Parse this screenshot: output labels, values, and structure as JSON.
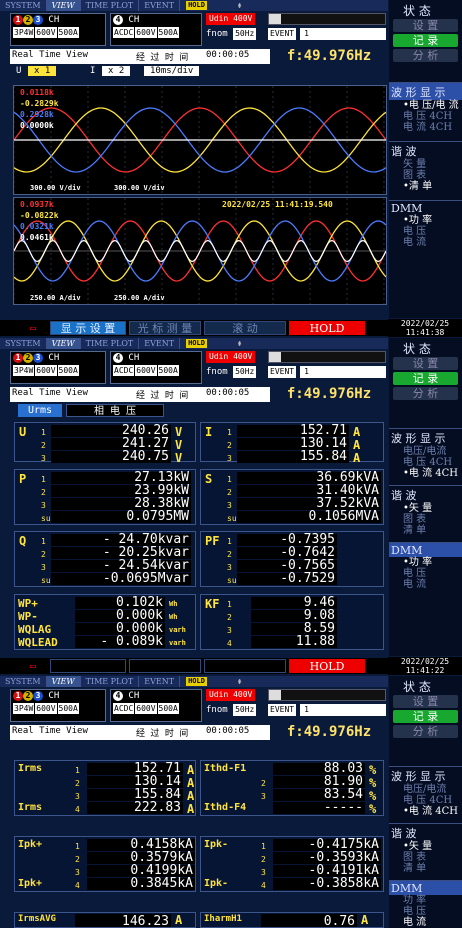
{
  "tabs": [
    "SYSTEM",
    "VIEW",
    "TIME PLOT",
    "EVENT"
  ],
  "hold_badge": "HOLD",
  "ch": {
    "ch_suffix": "CH",
    "ch4": "4",
    "wiring": "3P4W",
    "v_range": "600V",
    "a_range": "500A",
    "ch4_mode": "ACDC",
    "ch4_v": "600V",
    "ch4_a": "500A"
  },
  "udin": "Udin 400V",
  "fnom": "fnom",
  "fnom_val": "50Hz",
  "event": "EVENT",
  "event_count": "1",
  "rt": {
    "label": "Real Time View",
    "elapsed_label": "经 过 时 间",
    "elapsed": "00:00:05",
    "freq": "f:49.976Hz"
  },
  "zoom": {
    "u_label": "U",
    "u": "x 1",
    "i_label": "I",
    "i": "x 2",
    "tdiv": "10ms/div"
  },
  "wave1": {
    "v1": "0.0118k",
    "v2": "-0.2829k",
    "v3": "0.2928k",
    "v4": "0.0000k",
    "scale1": "300.00 V/div",
    "scale2": "300.00 V/div"
  },
  "wave2": {
    "a1": "0.0937k",
    "a2": "-0.0822k",
    "a3": "0.0321k",
    "a4": "0.0461k",
    "timestamp": "2022/02/25  11:41:19.540",
    "scale1": "250.00 A/div",
    "scale2": "250.00 A/div"
  },
  "bottom": {
    "b1": "显 示 设 置",
    "b2": "光 标 测 量",
    "b3": "滚 动",
    "hold": "HOLD"
  },
  "date1": "2022/02/25",
  "time1": "11:41:38",
  "date2": "2022/02/25",
  "time2": "11:41:22",
  "sidebar": {
    "status": "状 态",
    "set": "设 置",
    "rec": "记 录",
    "ana": "分 析",
    "wave": "波 形 显 示",
    "vc": "电压/电流",
    "v4": "电 压 4CH",
    "c4": "电 流 4CH",
    "harm": "谐 波",
    "vec": "矢 量",
    "graph": "图 表",
    "list": "清 单",
    "dmm": "DMM",
    "power": "功 率",
    "volt": "电 压",
    "curr": "电 流",
    "bullet": "•",
    "list_sel": "•清 单",
    "vc_sel": "•电 压/电 流",
    "power_sel": "•功 率",
    "curr4_sel": "•电 流 4CH",
    "vec_sel": "•矢 量"
  },
  "s2": {
    "urms_btn": "Urms",
    "phase_v": "相 电 压",
    "urms": {
      "label": "U",
      "sub": "rms",
      "rows": [
        [
          "1",
          "240.26",
          "V"
        ],
        [
          "2",
          "241.27",
          "V"
        ],
        [
          "3",
          "240.75",
          "V"
        ]
      ]
    },
    "irms": {
      "label": "I",
      "sub": "rms",
      "rows": [
        [
          "1",
          "152.71",
          "A"
        ],
        [
          "2",
          "130.14",
          "A"
        ],
        [
          "3",
          "155.84",
          "A"
        ]
      ]
    },
    "p": {
      "label": "P",
      "rows": [
        [
          "1",
          "27.13kW",
          ""
        ],
        [
          "2",
          "23.99kW",
          ""
        ],
        [
          "3",
          "28.38kW",
          ""
        ],
        [
          "sum",
          "0.0795MW",
          ""
        ]
      ]
    },
    "s": {
      "label": "S",
      "rows": [
        [
          "1",
          "36.69kVA",
          ""
        ],
        [
          "2",
          "31.40kVA",
          ""
        ],
        [
          "3",
          "37.52kVA",
          ""
        ],
        [
          "sum",
          "0.1056MVA",
          ""
        ]
      ]
    },
    "q": {
      "label": "Q",
      "rows": [
        [
          "1",
          "- 24.70kvar",
          ""
        ],
        [
          "2",
          "- 20.25kvar",
          ""
        ],
        [
          "3",
          "- 24.54kvar",
          ""
        ],
        [
          "sum",
          "-0.0695Mvar",
          ""
        ]
      ]
    },
    "pf": {
      "label": "PF",
      "rows": [
        [
          "1",
          "-0.7395",
          ""
        ],
        [
          "2",
          "-0.7642",
          ""
        ],
        [
          "3",
          "-0.7565",
          ""
        ],
        [
          "sum",
          "-0.7529",
          ""
        ]
      ]
    },
    "wp": {
      "rows": [
        [
          "WP+",
          "0.102k",
          "Wh"
        ],
        [
          "WP-",
          "0.000k",
          "Wh"
        ],
        [
          "WQLAG",
          "0.000k",
          "varh"
        ],
        [
          "WQLEAD",
          "- 0.089k",
          "varh"
        ]
      ]
    },
    "kf": {
      "label": "KF",
      "rows": [
        [
          "1",
          "9.46"
        ],
        [
          "2",
          "9.08"
        ],
        [
          "3",
          "8.59"
        ],
        [
          "4",
          "11.88"
        ]
      ]
    }
  },
  "s3": {
    "irms": {
      "rows": [
        [
          "Irms",
          "1",
          "152.71",
          "A"
        ],
        [
          "",
          "2",
          "130.14",
          "A"
        ],
        [
          "",
          "3",
          "155.84",
          "A"
        ],
        [
          "Irms",
          "4",
          "222.83",
          "A"
        ]
      ]
    },
    "ithd": {
      "rows": [
        [
          "Ithd-F1",
          "",
          "88.03",
          "%"
        ],
        [
          "",
          "2",
          "81.90",
          "%"
        ],
        [
          "",
          "3",
          "83.54",
          "%"
        ],
        [
          "Ithd-F4",
          "",
          "-----",
          "%"
        ]
      ]
    },
    "ipkp": {
      "rows": [
        [
          "Ipk+",
          "1",
          "0.4158kA",
          ""
        ],
        [
          "",
          "2",
          "0.3579kA",
          ""
        ],
        [
          "",
          "3",
          "0.4199kA",
          ""
        ],
        [
          "Ipk+",
          "4",
          "0.3845kA",
          ""
        ]
      ]
    },
    "ipkm": {
      "rows": [
        [
          "Ipk-",
          "1",
          "-0.4175kA",
          ""
        ],
        [
          "",
          "2",
          "-0.3593kA",
          ""
        ],
        [
          "",
          "3",
          "-0.4191kA",
          ""
        ],
        [
          "Ipk-",
          "4",
          "-0.3858kA",
          ""
        ]
      ]
    },
    "last": {
      "l1": "IrmsAVG",
      "v1": "146.23",
      "u1": "A",
      "l2": "IharmH1",
      "v2": "0.76",
      "u2": "A"
    }
  },
  "colors": {
    "bg": "#0a1a3a",
    "yellow": "#ffe43c",
    "red": "#ff3030",
    "green": "#18a830",
    "blue": "#4a7cff"
  }
}
